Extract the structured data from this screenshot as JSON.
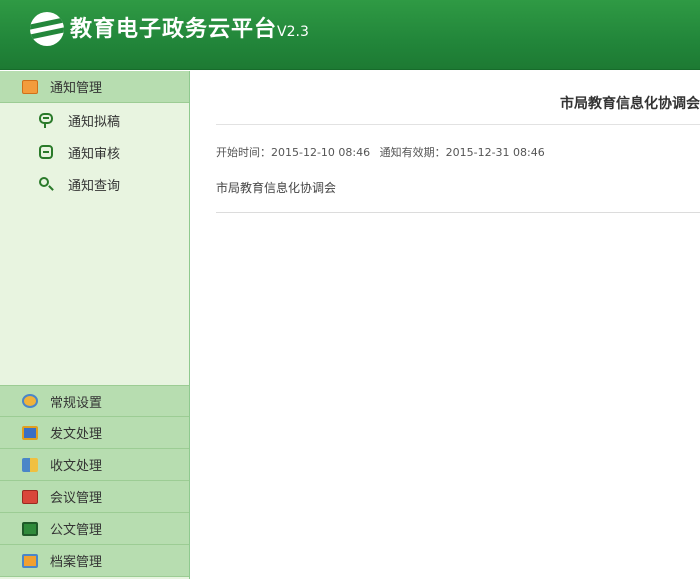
{
  "header": {
    "title": "教育电子政务云平台",
    "version": "V2.3",
    "logo_icon": "globe-logo-icon",
    "background": "#23873b"
  },
  "sidebar": {
    "active_section": {
      "label": "通知管理",
      "icon": "notice-manage-icon",
      "items": [
        {
          "label": "通知拟稿",
          "icon": "draft-bubble-icon"
        },
        {
          "label": "通知审核",
          "icon": "review-box-icon"
        },
        {
          "label": "通知查询",
          "icon": "search-icon"
        }
      ]
    },
    "sections": [
      {
        "label": "常规设置",
        "icon": "settings-icon"
      },
      {
        "label": "发文处理",
        "icon": "outgoing-doc-icon"
      },
      {
        "label": "收文处理",
        "icon": "incoming-doc-icon"
      },
      {
        "label": "会议管理",
        "icon": "meeting-icon"
      },
      {
        "label": "公文管理",
        "icon": "official-doc-icon"
      },
      {
        "label": "档案管理",
        "icon": "archive-icon"
      }
    ]
  },
  "notice": {
    "title": "市局教育信息化协调会",
    "start_label": "开始时间：",
    "start_time": "2015-12-10 08:46",
    "valid_label": "通知有效期：",
    "valid_until": "2015-12-31 08:46",
    "body": "市局教育信息化协调会"
  },
  "colors": {
    "header_green": "#23873b",
    "section_head_bg": "#b7ddb0",
    "sidebar_bg": "#e8f4e0",
    "icon_green": "#2a7a2a"
  }
}
